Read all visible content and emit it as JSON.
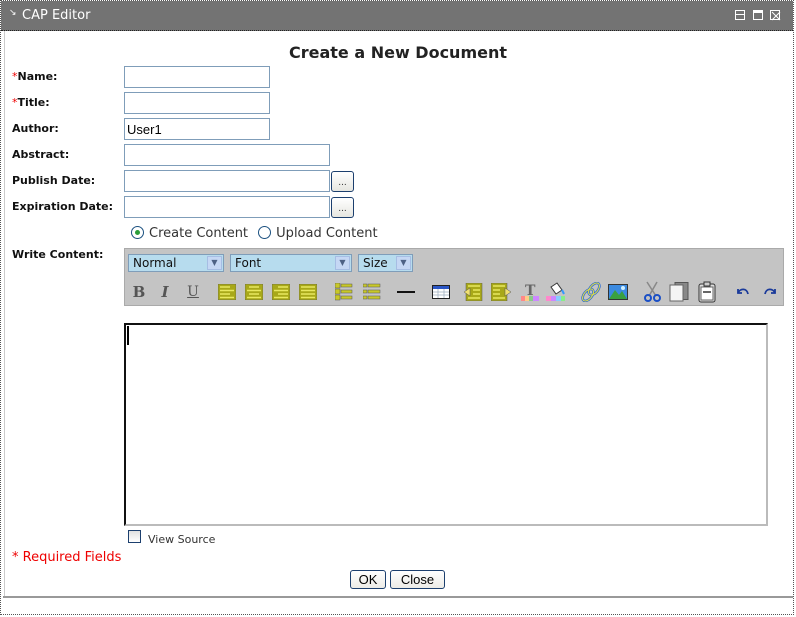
{
  "window": {
    "title": "CAP Editor",
    "controls": [
      "restore",
      "maximize",
      "close"
    ]
  },
  "form": {
    "heading": "Create a New Document",
    "required_marker": "*",
    "fields": {
      "name": {
        "label": "Name:",
        "value": "",
        "required": true
      },
      "title": {
        "label": "Title:",
        "value": "",
        "required": true
      },
      "author": {
        "label": "Author:",
        "value": "User1",
        "required": false
      },
      "abstract": {
        "label": "Abstract:",
        "value": "",
        "required": false
      },
      "publish_date": {
        "label": "Publish Date:",
        "value": "",
        "picker_label": "..."
      },
      "expiration_date": {
        "label": "Expiration Date:",
        "value": "",
        "picker_label": "..."
      }
    },
    "content_mode": {
      "options": [
        {
          "label": "Create Content",
          "selected": true
        },
        {
          "label": "Upload Content",
          "selected": false
        }
      ]
    },
    "write_content_label": "Write Content:"
  },
  "editor_toolbar": {
    "format_select": "Normal",
    "font_select": "Font",
    "size_select": "Size",
    "buttons": [
      "bold",
      "italic",
      "underline",
      "align-left",
      "align-center",
      "align-right",
      "justify",
      "ordered-list",
      "unordered-list",
      "horizontal-rule",
      "insert-table",
      "outdent",
      "indent",
      "text-color",
      "background-color",
      "insert-link",
      "insert-image",
      "cut",
      "copy",
      "paste",
      "undo",
      "redo"
    ]
  },
  "editor": {
    "content": ""
  },
  "view_source": {
    "label": "View Source",
    "checked": false
  },
  "required_note": "* Required Fields",
  "actions": {
    "ok_label": "OK",
    "close_label": "Close"
  }
}
